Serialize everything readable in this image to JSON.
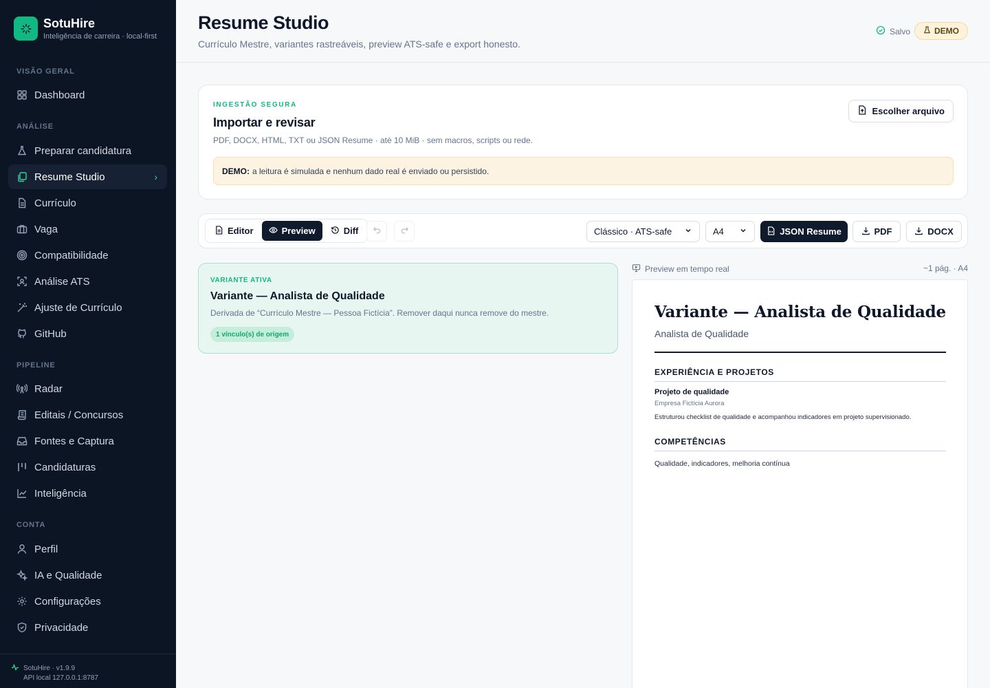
{
  "brand": {
    "name": "SotuHire",
    "tagline": "Inteligência de carreira · local-first"
  },
  "sidebar": {
    "sections": [
      {
        "label": "VISÃO GERAL",
        "items": [
          {
            "label": "Dashboard",
            "icon": "grid-icon"
          }
        ]
      },
      {
        "label": "ANÁLISE",
        "items": [
          {
            "label": "Preparar candidatura",
            "icon": "flask-icon"
          },
          {
            "label": "Resume Studio",
            "icon": "layers-icon",
            "active": true
          },
          {
            "label": "Currículo",
            "icon": "file-icon"
          },
          {
            "label": "Vaga",
            "icon": "briefcase-icon"
          },
          {
            "label": "Compatibilidade",
            "icon": "target-icon"
          },
          {
            "label": "Análise ATS",
            "icon": "scan-icon"
          },
          {
            "label": "Ajuste de Currículo",
            "icon": "wand-icon"
          },
          {
            "label": "GitHub",
            "icon": "github-icon"
          }
        ]
      },
      {
        "label": "PIPELINE",
        "items": [
          {
            "label": "Radar",
            "icon": "radar-icon"
          },
          {
            "label": "Editais / Concursos",
            "icon": "scroll-icon"
          },
          {
            "label": "Fontes e Captura",
            "icon": "inbox-icon"
          },
          {
            "label": "Candidaturas",
            "icon": "kanban-icon"
          },
          {
            "label": "Inteligência",
            "icon": "chart-icon"
          }
        ]
      },
      {
        "label": "CONTA",
        "items": [
          {
            "label": "Perfil",
            "icon": "user-icon"
          },
          {
            "label": "IA e Qualidade",
            "icon": "sparkle-icon"
          },
          {
            "label": "Configurações",
            "icon": "gear-icon"
          },
          {
            "label": "Privacidade",
            "icon": "shield-icon"
          }
        ]
      }
    ],
    "footer": {
      "version": "SotuHire · v1.9.9",
      "api": "API local 127.0.0.1:8787"
    }
  },
  "header": {
    "title": "Resume Studio",
    "subtitle": "Currículo Mestre, variantes rastreáveis, preview ATS-safe e export honesto.",
    "saved_label": "Salvo",
    "demo_label": "DEMO"
  },
  "import_card": {
    "kicker": "INGESTÃO SEGURA",
    "title": "Importar e revisar",
    "description": "PDF, DOCX, HTML, TXT ou JSON Resume · até 10 MiB · sem macros, scripts ou rede.",
    "choose_button": "Escolher arquivo",
    "notice_bold": "DEMO:",
    "notice_text": "a leitura é simulada e nenhum dado real é enviado ou persistido."
  },
  "toolbar": {
    "tabs": [
      {
        "label": "Editor",
        "icon": "file-icon"
      },
      {
        "label": "Preview",
        "icon": "eye-icon",
        "active": true
      },
      {
        "label": "Diff",
        "icon": "history-icon"
      }
    ],
    "template_select": "Clássico · ATS-safe",
    "paper_select": "A4",
    "json_button": "JSON Resume",
    "pdf_button": "PDF",
    "docx_button": "DOCX"
  },
  "variant": {
    "kicker": "VARIANTE ATIVA",
    "title": "Variante — Analista de Qualidade",
    "description": "Derivada de “Currículo Mestre — Pessoa Fictícia”. Remover daqui nunca remove do mestre.",
    "chip": "1 vínculo(s) de origem"
  },
  "preview": {
    "label": "Preview em tempo real",
    "pages": "~1 pág. · A4",
    "doc": {
      "title": "Variante — Analista de Qualidade",
      "role": "Analista de Qualidade",
      "section_experience": "EXPERIÊNCIA E PROJETOS",
      "item_title": "Projeto de qualidade",
      "item_company": "Empresa Fictícia Aurora",
      "item_desc": "Estruturou checklist de qualidade e acompanhou indicadores em projeto supervisionado.",
      "section_skills": "COMPETÊNCIAS",
      "skills": "Qualidade, indicadores, melhoria contínua"
    }
  },
  "colors": {
    "accent": "#10b981",
    "sidebar_bg": "#0b1524",
    "dark_button": "#0f1b2d",
    "demo_bg": "#fdf3dc"
  }
}
